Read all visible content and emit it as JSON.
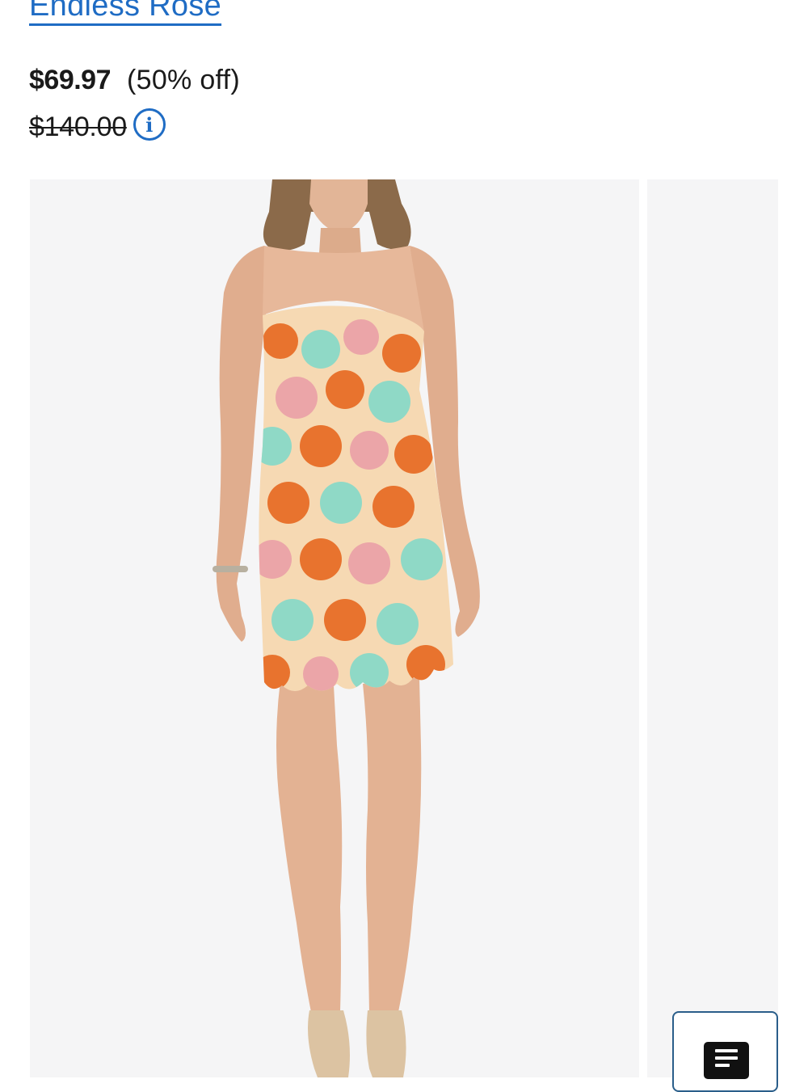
{
  "product": {
    "brand": "Endless Rose",
    "sale_price": "$69.97",
    "discount": "(50% off)",
    "original_price": "$140.00",
    "info_icon": "info-icon",
    "info_symbol": "i"
  },
  "gallery": {
    "main_image": "model-wearing-strapless-floral-lace-mini-dress",
    "next_image": "next-product-image-peek",
    "background": "#f5f5f6"
  },
  "chat": {
    "icon": "chat-lines-icon"
  },
  "colors": {
    "link_blue": "#1f6cc4",
    "text": "#1a1a1a",
    "lace_orange": "#e8732e",
    "lace_mint": "#8fd9c6",
    "lace_pink": "#eba5a8",
    "lace_cream": "#f6d9b3"
  }
}
